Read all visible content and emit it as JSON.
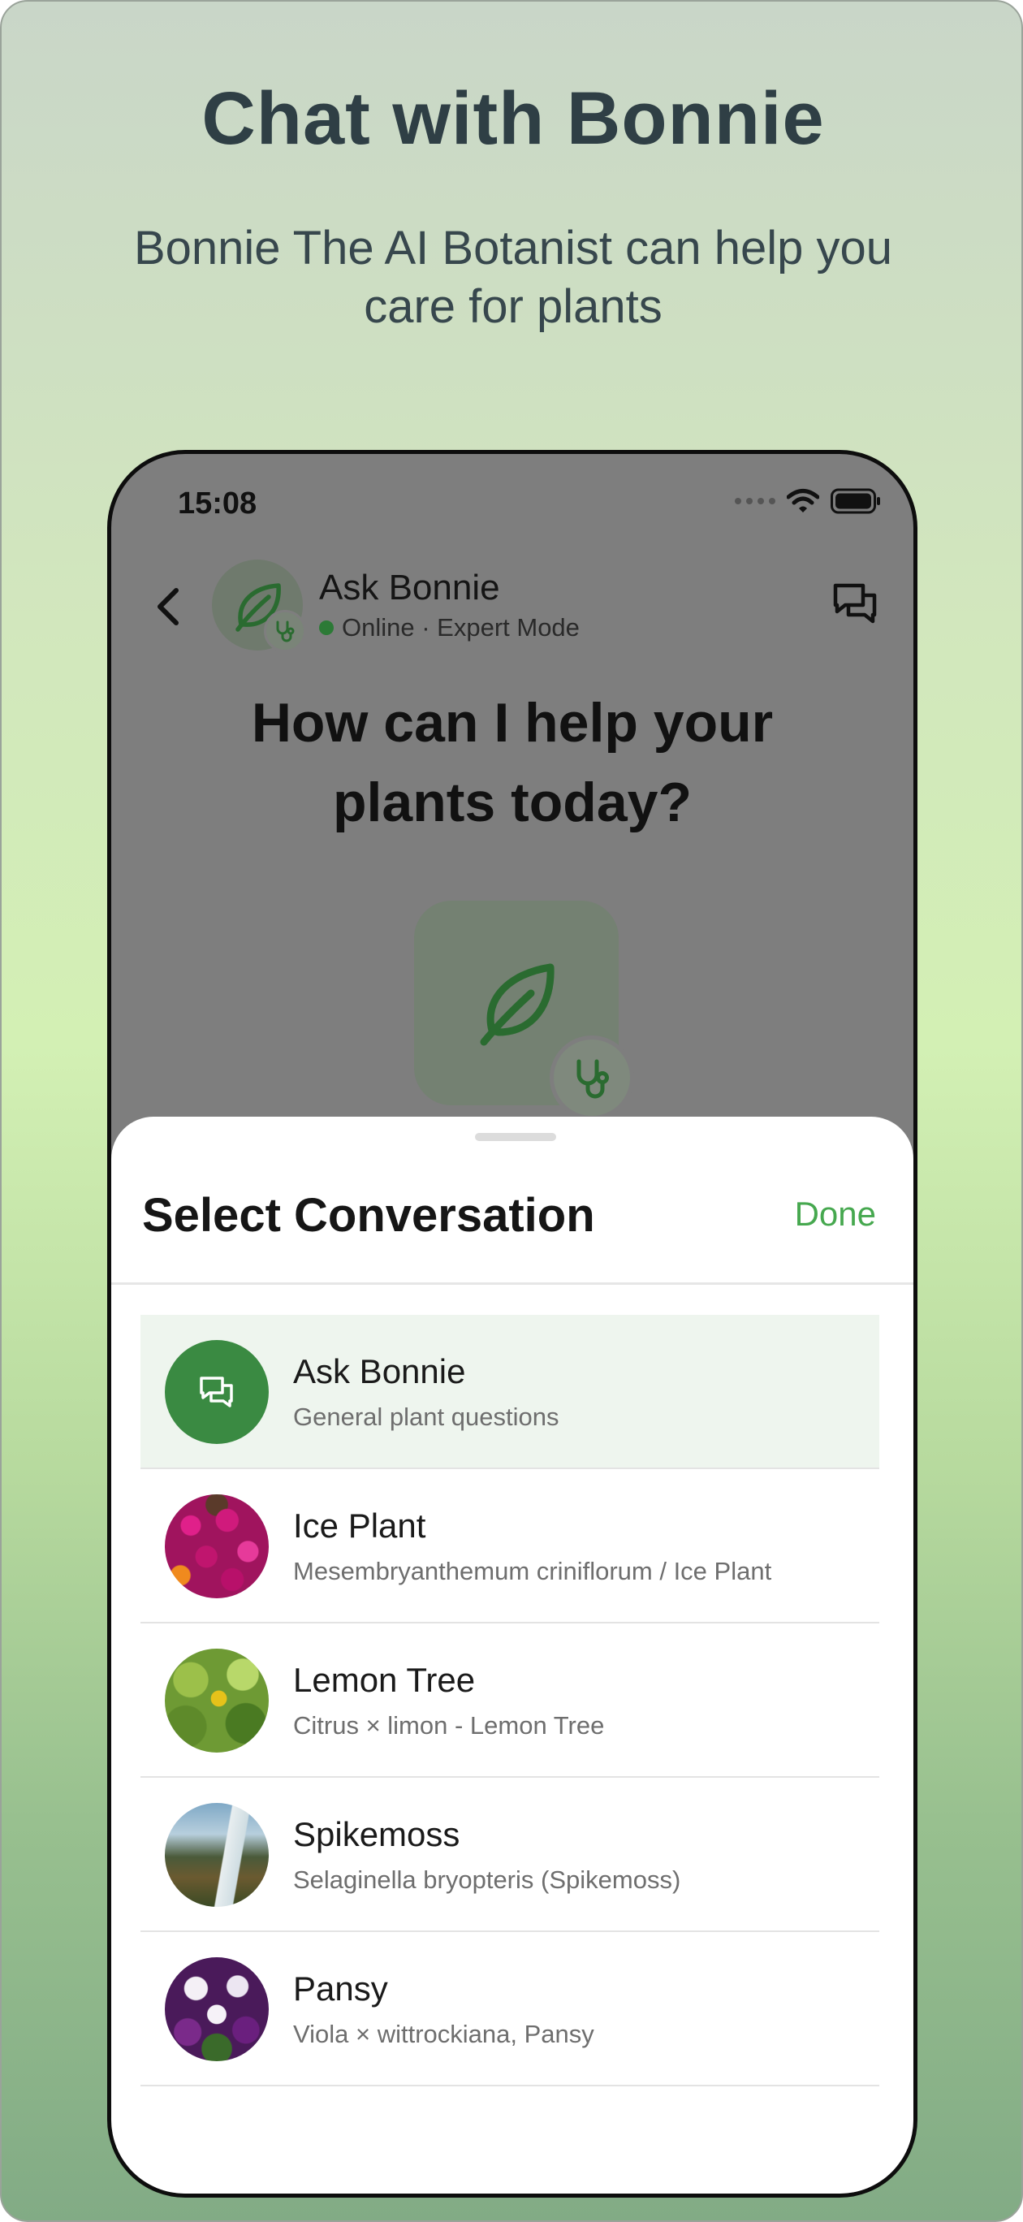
{
  "promo": {
    "title": "Chat with Bonnie",
    "subtitle": "Bonnie The AI Botanist can help you care for plants"
  },
  "status_bar": {
    "time": "15:08"
  },
  "chat_header": {
    "name": "Ask Bonnie",
    "status": "Online · Expert Mode"
  },
  "hero": {
    "question": "How can I help your plants today?"
  },
  "sheet": {
    "title": "Select Conversation",
    "done_label": "Done",
    "conversations": [
      {
        "name": "Ask Bonnie",
        "subtitle": "General plant questions"
      },
      {
        "name": "Ice Plant",
        "subtitle": "Mesembryanthemum criniflorum / Ice Plant"
      },
      {
        "name": "Lemon Tree",
        "subtitle": "Citrus × limon - Lemon Tree"
      },
      {
        "name": "Spikemoss",
        "subtitle": "Selaginella bryopteris (Spikemoss)"
      },
      {
        "name": "Pansy",
        "subtitle": "Viola × wittrockiana, Pansy"
      }
    ]
  },
  "colors": {
    "accent_green": "#3a8a42",
    "done_green": "#46a84f",
    "online_green": "#2c7a36",
    "title_text": "#2f3f45"
  },
  "icons": [
    "back-chevron-icon",
    "leaf-icon",
    "stethoscope-icon",
    "chat-bubbles-icon",
    "wifi-icon",
    "battery-icon"
  ]
}
